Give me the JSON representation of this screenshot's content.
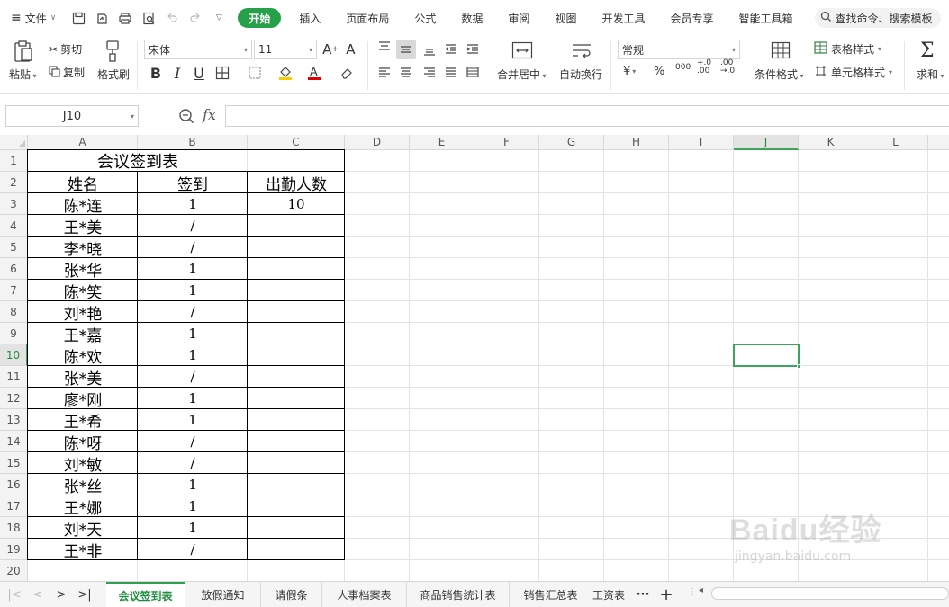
{
  "menubar": {
    "file_label": "文件",
    "tabs": [
      "开始",
      "插入",
      "页面布局",
      "公式",
      "数据",
      "审阅",
      "视图",
      "开发工具",
      "会员专享",
      "智能工具箱"
    ],
    "search_placeholder": "查找命令、搜索模板"
  },
  "ribbon": {
    "paste": "粘贴",
    "cut": "剪切",
    "copy": "复制",
    "format_painter": "格式刷",
    "font_name": "宋体",
    "font_size": "11",
    "merge_center": "合并居中",
    "wrap_text": "自动换行",
    "number_format": "常规",
    "conditional_format": "条件格式",
    "table_style": "表格样式",
    "cell_style": "单元格样式",
    "sum": "求和",
    "currency_symbol": "¥",
    "percent_symbol": "%",
    "thousands": "000",
    "inc_decimal": "+.0 .00",
    "dec_decimal": ".00 →.0"
  },
  "formula_bar": {
    "name_box": "J10",
    "fx": "fx",
    "formula": ""
  },
  "grid": {
    "columns": [
      "A",
      "B",
      "C",
      "D",
      "E",
      "F",
      "G",
      "H",
      "I",
      "J",
      "K",
      "L"
    ],
    "rows": [
      "1",
      "2",
      "3",
      "4",
      "5",
      "6",
      "7",
      "8",
      "9",
      "10",
      "11",
      "12",
      "13",
      "14",
      "15",
      "16",
      "17",
      "18",
      "19",
      "20"
    ],
    "selected_cell": "J10"
  },
  "table": {
    "title": "会议签到表",
    "headers": [
      "姓名",
      "签到",
      "出勤人数"
    ],
    "attendance_count": "10",
    "rows": [
      {
        "name": "陈*连",
        "sign": "1"
      },
      {
        "name": "王*美",
        "sign": "/"
      },
      {
        "name": "李*晓",
        "sign": "/"
      },
      {
        "name": "张*华",
        "sign": "1"
      },
      {
        "name": "陈*笑",
        "sign": "1"
      },
      {
        "name": "刘*艳",
        "sign": "/"
      },
      {
        "name": "王*嘉",
        "sign": "1"
      },
      {
        "name": "陈*欢",
        "sign": "1"
      },
      {
        "name": "张*美",
        "sign": "/"
      },
      {
        "name": "廖*刚",
        "sign": "1"
      },
      {
        "name": "王*希",
        "sign": "1"
      },
      {
        "name": "陈*呀",
        "sign": "/"
      },
      {
        "name": "刘*敏",
        "sign": "/"
      },
      {
        "name": "张*丝",
        "sign": "1"
      },
      {
        "name": "王*娜",
        "sign": "1"
      },
      {
        "name": "刘*天",
        "sign": "1"
      },
      {
        "name": "王*非",
        "sign": "/"
      }
    ]
  },
  "sheet_tabs": {
    "tabs": [
      "会议签到表",
      "放假通知",
      "请假条",
      "人事档案表",
      "商品销售统计表",
      "销售汇总表",
      "工资表"
    ],
    "active": "会议签到表",
    "more": "···",
    "add": "+"
  },
  "watermark": {
    "brand": "Baidu经验",
    "url": "jingyan.baidu.com"
  },
  "colors": {
    "accent": "#26a14a",
    "selection": "#3ba55c"
  }
}
